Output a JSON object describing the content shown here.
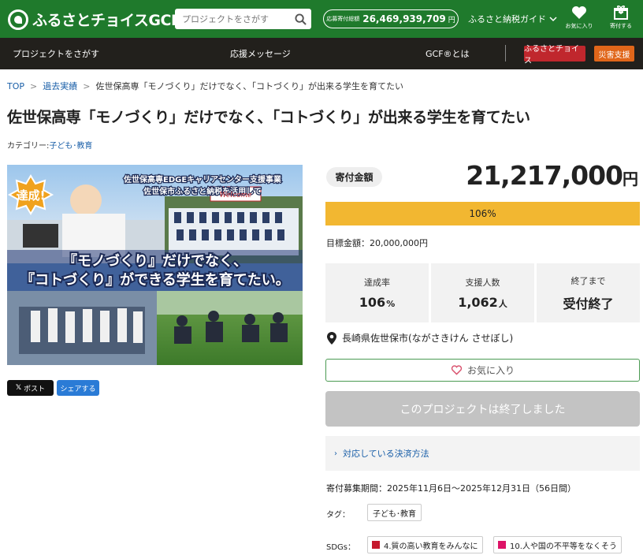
{
  "header": {
    "logo_text": "ふるさとチョイスGCF",
    "search_placeholder": "プロジェクトをさがす",
    "total_label": "応募寄付総額",
    "total_amount": "26,469,939,709",
    "total_unit": "円",
    "guide_label": "ふるさと納税ガイド",
    "favorites_label": "お気に入り",
    "donate_label": "寄付する"
  },
  "nav": {
    "find_projects": "プロジェクトをさがす",
    "support_messages": "応援メッセージ",
    "about_gcf": "GCF®とは",
    "furusato_choice": "ふるさとチョイス",
    "disaster_support": "災害支援",
    "colors": {
      "furusato_choice": "#c0272d",
      "disaster_support": "#e0661a"
    }
  },
  "breadcrumb": {
    "top": "TOP",
    "past": "過去実績",
    "current": "佐世保高専「モノづくり」だけでなく､「コトづくり」が出来る学生を育てたい"
  },
  "project": {
    "title": "佐世保高専「モノづくり」だけでなく､「コトづくり」が出来る学生を育てたい",
    "category_label": "カテゴリー:",
    "category_value": "子ども･教育",
    "image": {
      "badge": "達成!",
      "line1": "佐世保高専EDGEキャリアセンター支援事業",
      "line2": "佐世保市ふるさと納税を活用して",
      "headline1": "『モノづくり』だけでなく、",
      "headline2": "『コトづくり』ができる学生を育てたい。",
      "sign": "Welcome"
    },
    "share_x": "ポスト",
    "share_fb": "シェアする"
  },
  "funding": {
    "label": "寄付金額",
    "amount": "21,217,000",
    "unit": "円",
    "progress_text": "106%",
    "progress_fraction": 1.0,
    "target_text": "目標金額：20,000,000円",
    "stats": [
      {
        "key": "達成率",
        "value": "106",
        "unit": "%"
      },
      {
        "key": "支援人数",
        "value": "1,062",
        "unit": "人"
      },
      {
        "key": "終了まで",
        "value": "受付終了",
        "unit": ""
      }
    ],
    "location": "長崎県佐世保市(ながさきけん させぼし)",
    "favorite_button": "お気に入り",
    "ended_button": "このプロジェクトは終了しました",
    "payment_methods": "対応している決済方法",
    "period": "寄付募集期間：2025年11月6日～2025年12月31日（56日間）",
    "tag_label": "タグ：",
    "tag_value": "子ども･教育",
    "sdgs_label": "SDGs：",
    "sdgs": [
      {
        "label": "4.質の高い教育をみんなに",
        "color": "#c5192d"
      },
      {
        "label": "10.人や国の不平等をなくそう",
        "color": "#dd1367"
      }
    ]
  }
}
